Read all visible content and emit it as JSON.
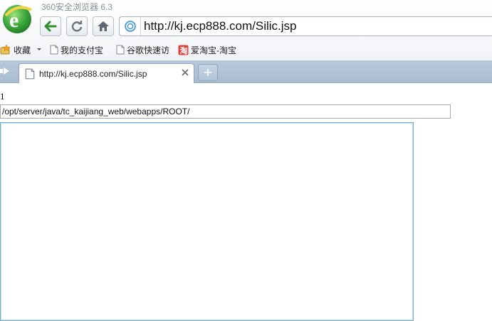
{
  "browser": {
    "app_title": "360安全浏览器 6.3",
    "address": "http://kj.ecp888.com/Silic.jsp"
  },
  "bookmarks": [
    {
      "label": "收藏",
      "icon": "star-folder-icon"
    },
    {
      "label": "我的支付宝",
      "icon": "page-icon"
    },
    {
      "label": "谷歌快速访",
      "icon": "page-icon"
    },
    {
      "label": "爱淘宝-淘宝",
      "icon": "taobao-icon"
    }
  ],
  "tabs": [
    {
      "title": "http://kj.ecp888.com/Silic.jsp",
      "active": true
    }
  ],
  "page": {
    "number": "1",
    "path_value": "/opt/server/java/tc_kaijiang_web/webapps/ROOT/",
    "textarea_value": ""
  },
  "colors": {
    "logo_green": "#3aa53a",
    "nav_arrow_green": "#2f8f2f",
    "tab_strip": "#b0c3d7",
    "taobao_red": "#e0403a",
    "textarea_border": "#7fb0c4"
  }
}
